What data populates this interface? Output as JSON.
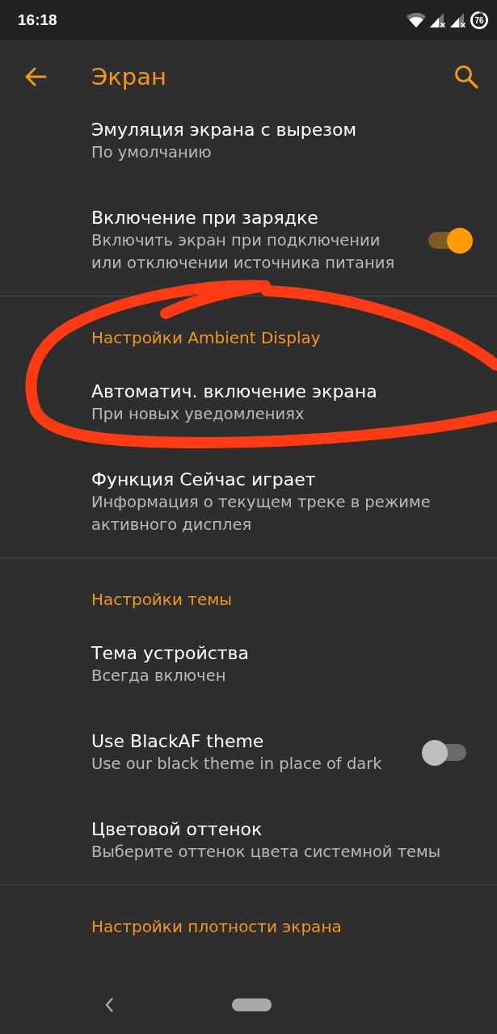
{
  "status_bar": {
    "time": "16:18",
    "battery": "76"
  },
  "app_bar": {
    "title": "Экран"
  },
  "sections": [
    {
      "items": [
        {
          "kind": "text",
          "title": "Эмуляция экрана с вырезом",
          "summary": "По умолчанию"
        },
        {
          "kind": "switch",
          "title": "Включение при зарядке",
          "summary": "Включить экран при подключении или отключении источника питания",
          "on": true
        }
      ]
    },
    {
      "category": "Настройки Ambient Display",
      "items": [
        {
          "kind": "text",
          "title": "Автоматич. включение экрана",
          "summary": "При новых уведомлениях"
        },
        {
          "kind": "text",
          "title": "Функция Сейчас играет",
          "summary": "Информация о текущем треке в режиме активного дисплея"
        }
      ]
    },
    {
      "category": "Настройки темы",
      "items": [
        {
          "kind": "text",
          "title": "Тема устройства",
          "summary": "Всегда включен"
        },
        {
          "kind": "switch",
          "title": "Use BlackAF theme",
          "summary": "Use our black theme in place of dark",
          "on": false
        },
        {
          "kind": "text",
          "title": "Цветовой оттенок",
          "summary": "Выберите оттенок цвета системной темы"
        }
      ]
    },
    {
      "category": "Настройки плотности экрана"
    }
  ],
  "hand_drawn_loop": true
}
